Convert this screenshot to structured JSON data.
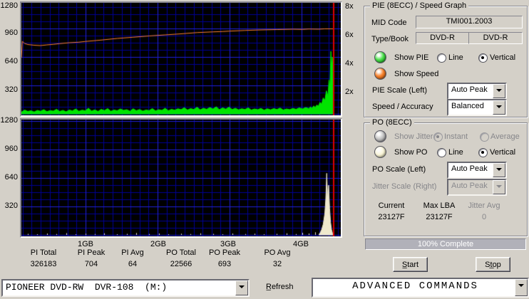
{
  "colors": {
    "led_green": [
      "#4ee24e",
      "#0c860c"
    ],
    "led_orange": [
      "#f8832e",
      "#a84a08"
    ],
    "led_pale": [
      "#faf6dc",
      "#bdb88e"
    ],
    "led_disabled": [
      "#c6c6c6",
      "#808080"
    ]
  },
  "axes": {
    "left": [
      "1280",
      "960",
      "640",
      "320"
    ],
    "right": [
      "8x",
      "6x",
      "4x",
      "2x"
    ],
    "x": [
      "1GB",
      "2GB",
      "3GB",
      "4GB"
    ]
  },
  "chart_data": [
    {
      "type": "area",
      "title": "PIE (8ECC) / Speed Graph",
      "left_axis": {
        "min": 0,
        "max": 1280,
        "ticks": [
          1280,
          960,
          640,
          320
        ]
      },
      "right_axis": {
        "min": 0,
        "max": 8,
        "ticks": [
          "8x",
          "6x",
          "4x",
          "2x"
        ]
      },
      "x_axis": {
        "ticks": [
          "1GB",
          "2GB",
          "3GB",
          "4GB"
        ]
      },
      "grid": true,
      "bg": "#000000",
      "grid_colors": {
        "minor": "#000096",
        "major": "#2121d8"
      },
      "cursor_x": 0.978,
      "cursor_color": "#dd0000",
      "series": [
        {
          "name": "PIE",
          "style": "area",
          "color": "#00e400",
          "points": [
            [
              0,
              20
            ],
            [
              0.01,
              44
            ],
            [
              0.02,
              28
            ],
            [
              0.03,
              36
            ],
            [
              0.04,
              22
            ],
            [
              0.05,
              40
            ],
            [
              0.06,
              30
            ],
            [
              0.07,
              48
            ],
            [
              0.08,
              26
            ],
            [
              0.09,
              38
            ],
            [
              0.1,
              32
            ],
            [
              0.11,
              52
            ],
            [
              0.12,
              28
            ],
            [
              0.13,
              40
            ],
            [
              0.14,
              24
            ],
            [
              0.15,
              44
            ],
            [
              0.16,
              34
            ],
            [
              0.17,
              56
            ],
            [
              0.18,
              30
            ],
            [
              0.19,
              42
            ],
            [
              0.2,
              36
            ],
            [
              0.21,
              64
            ],
            [
              0.22,
              32
            ],
            [
              0.23,
              46
            ],
            [
              0.24,
              28
            ],
            [
              0.25,
              52
            ],
            [
              0.26,
              38
            ],
            [
              0.27,
              60
            ],
            [
              0.28,
              30
            ],
            [
              0.29,
              44
            ],
            [
              0.3,
              36
            ],
            [
              0.31,
              56
            ],
            [
              0.32,
              40
            ],
            [
              0.33,
              48
            ],
            [
              0.34,
              30
            ],
            [
              0.35,
              58
            ],
            [
              0.36,
              36
            ],
            [
              0.37,
              50
            ],
            [
              0.38,
              32
            ],
            [
              0.39,
              44
            ],
            [
              0.4,
              38
            ],
            [
              0.41,
              60
            ],
            [
              0.42,
              34
            ],
            [
              0.43,
              48
            ],
            [
              0.44,
              40
            ],
            [
              0.45,
              64
            ],
            [
              0.46,
              36
            ],
            [
              0.47,
              52
            ],
            [
              0.48,
              42
            ],
            [
              0.49,
              58
            ],
            [
              0.5,
              48
            ],
            [
              0.51,
              70
            ],
            [
              0.52,
              44
            ],
            [
              0.53,
              60
            ],
            [
              0.54,
              50
            ],
            [
              0.55,
              76
            ],
            [
              0.56,
              46
            ],
            [
              0.57,
              64
            ],
            [
              0.58,
              52
            ],
            [
              0.59,
              72
            ],
            [
              0.6,
              56
            ],
            [
              0.61,
              80
            ],
            [
              0.62,
              48
            ],
            [
              0.63,
              68
            ],
            [
              0.64,
              54
            ],
            [
              0.65,
              76
            ],
            [
              0.66,
              50
            ],
            [
              0.67,
              64
            ],
            [
              0.68,
              46
            ],
            [
              0.69,
              58
            ],
            [
              0.7,
              50
            ],
            [
              0.71,
              68
            ],
            [
              0.72,
              44
            ],
            [
              0.73,
              56
            ],
            [
              0.74,
              48
            ],
            [
              0.75,
              62
            ],
            [
              0.76,
              42
            ],
            [
              0.77,
              58
            ],
            [
              0.78,
              46
            ],
            [
              0.79,
              60
            ],
            [
              0.8,
              50
            ],
            [
              0.81,
              66
            ],
            [
              0.82,
              44
            ],
            [
              0.83,
              56
            ],
            [
              0.84,
              48
            ],
            [
              0.85,
              62
            ],
            [
              0.86,
              52
            ],
            [
              0.87,
              68
            ],
            [
              0.88,
              56
            ],
            [
              0.89,
              72
            ],
            [
              0.9,
              60
            ],
            [
              0.905,
              80
            ],
            [
              0.91,
              64
            ],
            [
              0.915,
              90
            ],
            [
              0.92,
              74
            ],
            [
              0.925,
              100
            ],
            [
              0.93,
              88
            ],
            [
              0.935,
              130
            ],
            [
              0.94,
              110
            ],
            [
              0.945,
              180
            ],
            [
              0.95,
              150
            ],
            [
              0.955,
              260
            ],
            [
              0.96,
              200
            ],
            [
              0.963,
              380
            ],
            [
              0.966,
              300
            ],
            [
              0.969,
              704
            ],
            [
              0.972,
              520
            ],
            [
              0.974,
              640
            ],
            [
              0.976,
              300
            ],
            [
              0.978,
              80
            ]
          ]
        },
        {
          "name": "Speed",
          "style": "line",
          "color": "#ff8030",
          "points": [
            [
              0,
              632
            ],
            [
              0.003,
              816
            ],
            [
              0.01,
              792
            ],
            [
              0.02,
              780
            ],
            [
              0.04,
              772
            ],
            [
              0.06,
              768
            ],
            [
              0.08,
              776
            ],
            [
              0.1,
              782
            ],
            [
              0.12,
              790
            ],
            [
              0.15,
              800
            ],
            [
              0.18,
              806
            ],
            [
              0.2,
              814
            ],
            [
              0.25,
              830
            ],
            [
              0.3,
              848
            ],
            [
              0.35,
              862
            ],
            [
              0.4,
              876
            ],
            [
              0.45,
              888
            ],
            [
              0.5,
              900
            ],
            [
              0.55,
              914
            ],
            [
              0.6,
              922
            ],
            [
              0.63,
              926
            ],
            [
              0.65,
              930
            ],
            [
              0.7,
              938
            ],
            [
              0.75,
              944
            ],
            [
              0.8,
              948
            ],
            [
              0.85,
              952
            ],
            [
              0.88,
              950
            ],
            [
              0.9,
              954
            ],
            [
              0.93,
              952
            ],
            [
              0.95,
              956
            ],
            [
              0.978,
              956
            ]
          ]
        }
      ]
    },
    {
      "type": "bar",
      "title": "PO (8ECC)",
      "left_axis": {
        "min": 0,
        "max": 1280,
        "ticks": [
          1280,
          960,
          640,
          320
        ]
      },
      "x_axis": {
        "ticks": [
          "1GB",
          "2GB",
          "3GB",
          "4GB"
        ]
      },
      "grid": true,
      "bg": "#000000",
      "grid_colors": {
        "minor": "#000096",
        "major": "#2121d8"
      },
      "cursor_x": 0.978,
      "cursor_color": "#dd0000",
      "series": [
        {
          "name": "PO",
          "style": "spikes",
          "color": "#efe9cd",
          "points": [
            [
              0.02,
              12
            ],
            [
              0.05,
              8
            ],
            [
              0.08,
              16
            ],
            [
              0.11,
              10
            ],
            [
              0.14,
              20
            ],
            [
              0.17,
              8
            ],
            [
              0.2,
              14
            ],
            [
              0.23,
              10
            ],
            [
              0.26,
              18
            ],
            [
              0.3,
              8
            ],
            [
              0.33,
              12
            ],
            [
              0.36,
              22
            ],
            [
              0.4,
              10
            ],
            [
              0.43,
              16
            ],
            [
              0.46,
              8
            ],
            [
              0.5,
              14
            ],
            [
              0.53,
              10
            ],
            [
              0.56,
              18
            ],
            [
              0.6,
              12
            ],
            [
              0.63,
              8
            ],
            [
              0.66,
              16
            ],
            [
              0.7,
              10
            ],
            [
              0.73,
              14
            ],
            [
              0.76,
              8
            ],
            [
              0.8,
              12
            ],
            [
              0.83,
              18
            ],
            [
              0.86,
              10
            ],
            [
              0.88,
              24
            ],
            [
              0.9,
              16
            ],
            [
              0.92,
              30
            ]
          ]
        },
        {
          "name": "PO burst",
          "style": "area",
          "color": "#efe9cd",
          "points": [
            [
              0.932,
              10
            ],
            [
              0.935,
              20
            ],
            [
              0.94,
              60
            ],
            [
              0.945,
              120
            ],
            [
              0.95,
              240
            ],
            [
              0.953,
              400
            ],
            [
              0.956,
              693
            ],
            [
              0.959,
              380
            ],
            [
              0.962,
              560
            ],
            [
              0.965,
              300
            ],
            [
              0.968,
              140
            ],
            [
              0.971,
              60
            ],
            [
              0.974,
              20
            ],
            [
              0.976,
              6
            ]
          ]
        }
      ]
    }
  ],
  "stats": {
    "items": [
      {
        "label": "PI Total",
        "value": "326183"
      },
      {
        "label": "PI Peak",
        "value": "704"
      },
      {
        "label": "PI Avg",
        "value": "64"
      },
      {
        "label": "PO Total",
        "value": "22566"
      },
      {
        "label": "PO Peak",
        "value": "693"
      },
      {
        "label": "PO Avg",
        "value": "32"
      }
    ]
  },
  "panel": {
    "pie": {
      "title": "PIE (8ECC) / Speed Graph",
      "mid_label": "MID Code",
      "mid_value": "TMI001.2003",
      "type_label": "Type/Book",
      "type_value_1": "DVD-R",
      "type_value_2": "DVD-R",
      "show_pie": "Show PIE",
      "show_speed": "Show Speed",
      "line": "Line",
      "vertical": "Vertical",
      "pie_scale_label": "PIE Scale (Left)",
      "pie_scale_value": "Auto Peak",
      "speed_accuracy_label": "Speed / Accuracy",
      "speed_accuracy_value": "Balanced"
    },
    "po": {
      "title": "PO (8ECC)",
      "show_jitter": "Show Jitter",
      "instant": "Instant",
      "average": "Average",
      "show_po": "Show PO",
      "line": "Line",
      "vertical": "Vertical",
      "po_scale_label": "PO Scale (Left)",
      "po_scale_value": "Auto Peak",
      "jitter_scale_label": "Jitter Scale (Right)",
      "jitter_scale_value": "Auto Peak",
      "current_label": "Current",
      "current_value": "23127F",
      "max_lba_label": "Max LBA",
      "max_lba_value": "23127F",
      "jitter_avg_label": "Jitter Avg",
      "jitter_avg_value": "0"
    },
    "progress_text": "100% Complete",
    "start_label": "S̲tart",
    "stop_label": "St̲op"
  },
  "bottom": {
    "device": "PIONEER DVD-RW  DVR-108  (M:)",
    "refresh_label": "R̲efresh",
    "advanced": "ADVANCED COMMANDS"
  }
}
